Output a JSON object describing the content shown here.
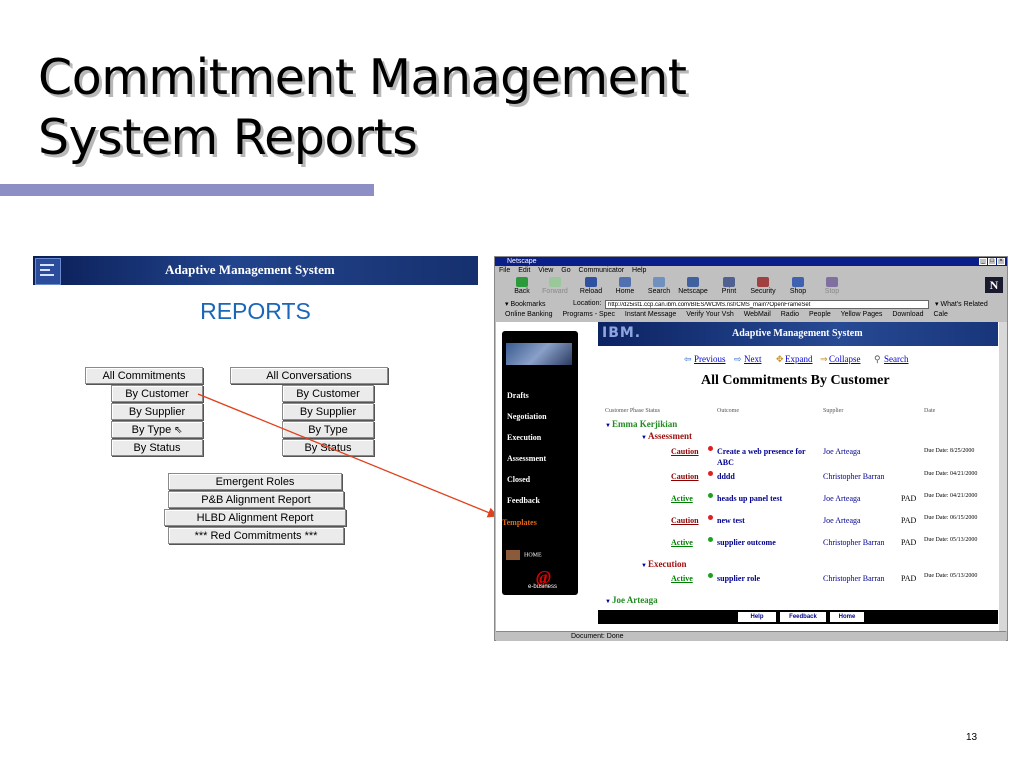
{
  "slide": {
    "title": "Commitment Management\nSystem Reports",
    "page_number": "13"
  },
  "left_panel": {
    "header_title": "Adaptive Management System",
    "heading": "REPORTS",
    "commitments": [
      "All Commitments",
      "By Customer",
      "By Supplier",
      "By Type",
      "By Status"
    ],
    "conversations": [
      "All Conversations",
      "By Customer",
      "By Supplier",
      "By Type",
      "By Status"
    ],
    "other_reports": [
      "Emergent Roles",
      "P&B Alignment Report",
      "HLBD Alignment Report",
      "*** Red Commitments ***"
    ]
  },
  "browser": {
    "window_title": "Netscape",
    "menu": [
      "File",
      "Edit",
      "View",
      "Go",
      "Communicator",
      "Help"
    ],
    "toolbar": [
      "Back",
      "Forward",
      "Reload",
      "Home",
      "Search",
      "Netscape",
      "Print",
      "Security",
      "Shop",
      "Stop"
    ],
    "bookmarks_label": "Bookmarks",
    "location_label": "Location:",
    "url": "http://d25ist1.ccp.can.ibm.com/BIES/WCMS.nsf/CMS_main?OpenFrameSet",
    "whats_related": "What's Related",
    "personal_toolbar": [
      "Online Banking",
      "Programs - Spec",
      "Instant Message",
      "Verify Your Vsh",
      "WebMail",
      "Radio",
      "People",
      "Yellow Pages",
      "Download",
      "Cale"
    ],
    "status_text": "Document: Done"
  },
  "app": {
    "logo_text": "IBM.",
    "header_title": "Adaptive Management System",
    "sidebar": [
      "Drafts",
      "Negotiation",
      "Execution",
      "Assessment",
      "Closed",
      "Feedback",
      "Templates"
    ],
    "home_label": "HOME",
    "ebusiness_logo": "@",
    "ebusiness_label": "e-business",
    "nav": {
      "previous": "Previous",
      "next": "Next",
      "expand": "Expand",
      "collapse": "Collapse",
      "search": "Search"
    },
    "report_title": "All Commitments By Customer",
    "columns": {
      "customer_phase_status": "Customer Phase Status",
      "outcome": "Outcome",
      "supplier": "Supplier",
      "date": "Date"
    },
    "customers": [
      "Emma Kerjikian",
      "Joe Arteaga"
    ],
    "phases": [
      "Assessment",
      "Execution"
    ],
    "rows": [
      {
        "status": "Caution",
        "outcome": "Create a web presence for ABC",
        "supplier": "Joe Arteaga",
        "pad": "",
        "date": "Due Date: 8/25/2000"
      },
      {
        "status": "Caution",
        "outcome": "dddd",
        "supplier": "Christopher Barran",
        "pad": "",
        "date": "Due Date: 04/21/2000"
      },
      {
        "status": "Active",
        "outcome": "heads up panel test",
        "supplier": "Joe Arteaga",
        "pad": "PAD",
        "date": "Due Date: 04/21/2000"
      },
      {
        "status": "Caution",
        "outcome": "new test",
        "supplier": "Joe Arteaga",
        "pad": "PAD",
        "date": "Due Date: 06/15/2000"
      },
      {
        "status": "Active",
        "outcome": "supplier outcome",
        "supplier": "Christopher Barran",
        "pad": "PAD",
        "date": "Due Date: 05/13/2000"
      },
      {
        "status": "Active",
        "outcome": "supplier role",
        "supplier": "Christopher Barran",
        "pad": "PAD",
        "date": "Due Date: 05/13/2000"
      }
    ],
    "bottom_buttons": [
      "Help",
      "Feedback",
      "Home"
    ]
  },
  "colors": {
    "title_bar": "#8e8ec6",
    "caution": "#8b0000",
    "active": "#008000",
    "arrow": "#e0401a"
  }
}
